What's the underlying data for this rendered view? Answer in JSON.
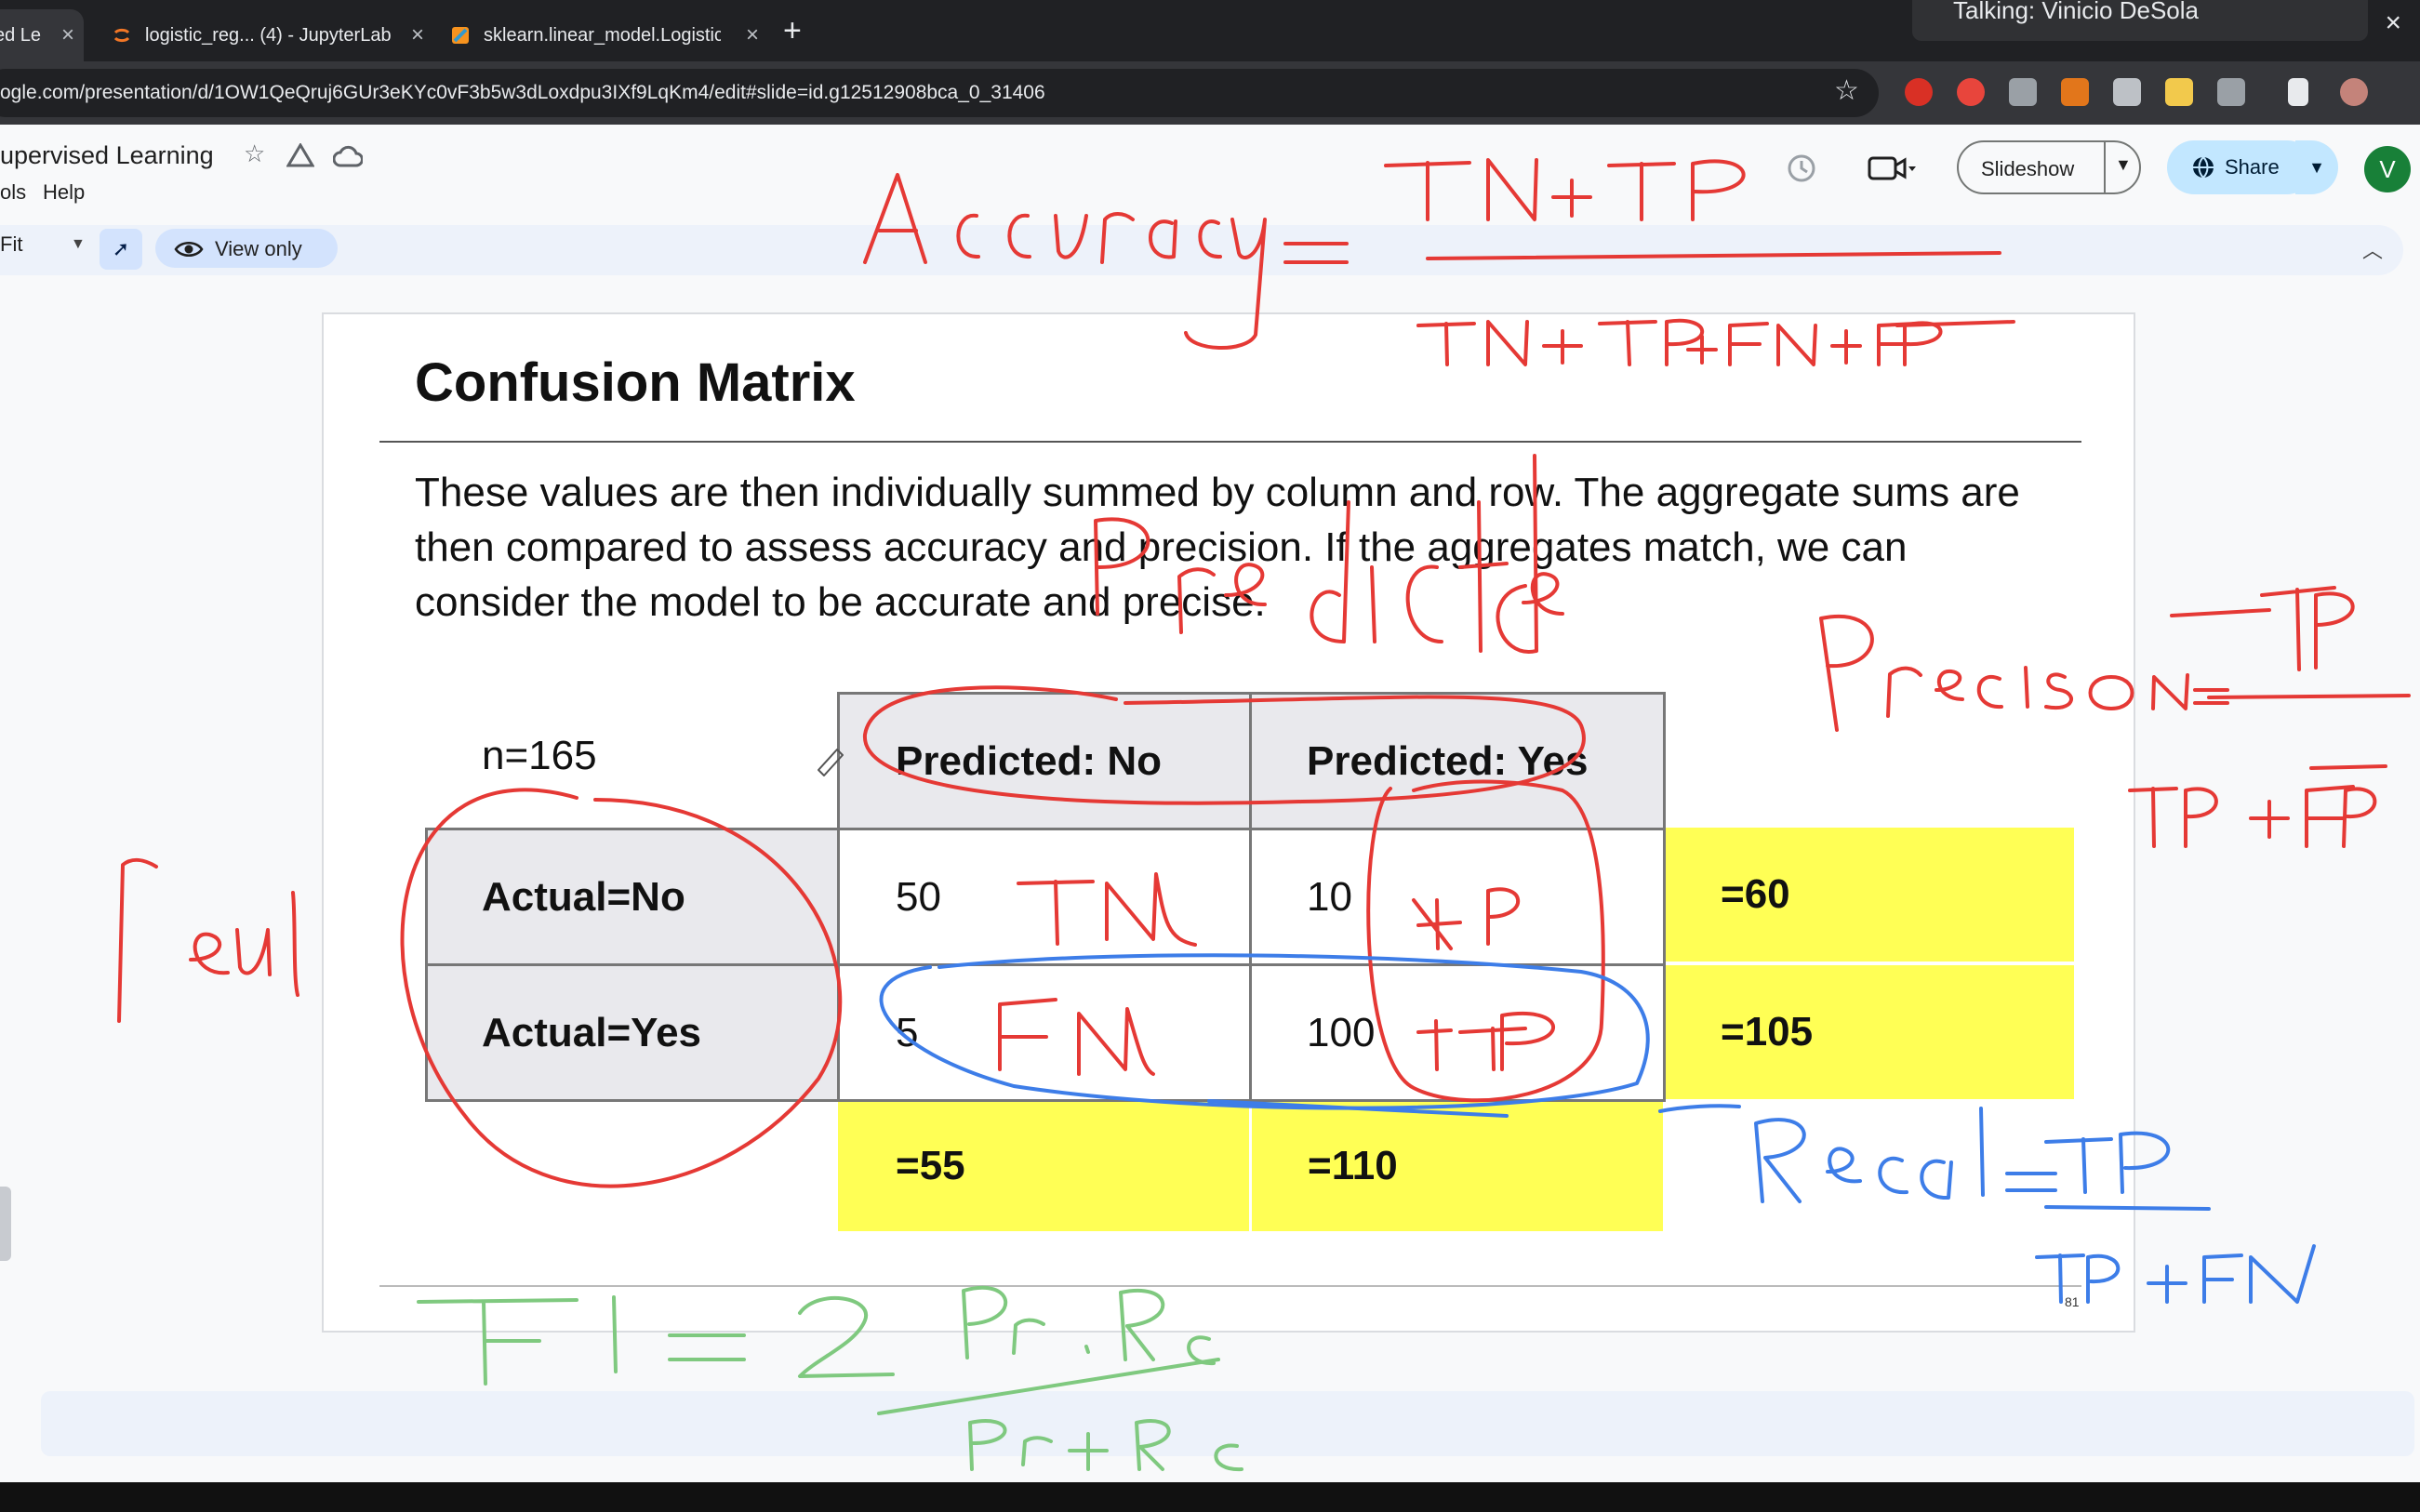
{
  "browser": {
    "tabs": [
      {
        "label": "ed Le"
      },
      {
        "label": "logistic_reg... (4) - JupyterLab"
      },
      {
        "label": "sklearn.linear_model.LogisticRe"
      }
    ],
    "close_glyph": "×",
    "new_tab_glyph": "+",
    "popup_text": "Talking: Vinicio DeSola",
    "url": "ogle.com/presentation/d/1OW1QeQruj6GUr3eKYc0vF3b5w3dLoxdpu3IXf9LqKm4/edit#slide=id.g12512908bca_0_31406"
  },
  "app": {
    "doc_title": "upervised Learning",
    "menu": [
      "ols",
      "Help"
    ],
    "slideshow_label": "Slideshow",
    "share_label": "Share",
    "avatar_letter": "V",
    "zoom_label": "Fit",
    "view_only_label": "View only"
  },
  "slide": {
    "title": "Confusion Matrix",
    "body": "These values are then individually summed by column and row. The aggregate sums are then compared to assess accuracy and precision. If the aggregates match, we can consider the model to be accurate and precise.",
    "slide_number": "81",
    "matrix": {
      "n_label": "n=165",
      "col_headers": [
        "Predicted: No",
        "Predicted: Yes"
      ],
      "row_headers": [
        "Actual=No",
        "Actual=Yes"
      ],
      "cells": [
        [
          "50",
          "10"
        ],
        [
          "5",
          "100"
        ]
      ],
      "row_totals": [
        "=60",
        "=105"
      ],
      "col_totals": [
        "=55",
        "=110"
      ]
    }
  },
  "colors": {
    "yellow": "#ffff55",
    "header_gray": "#e9e9ed",
    "ink_red": "#e53935",
    "ink_blue": "#3d7de8",
    "ink_green": "#7fc97f"
  }
}
